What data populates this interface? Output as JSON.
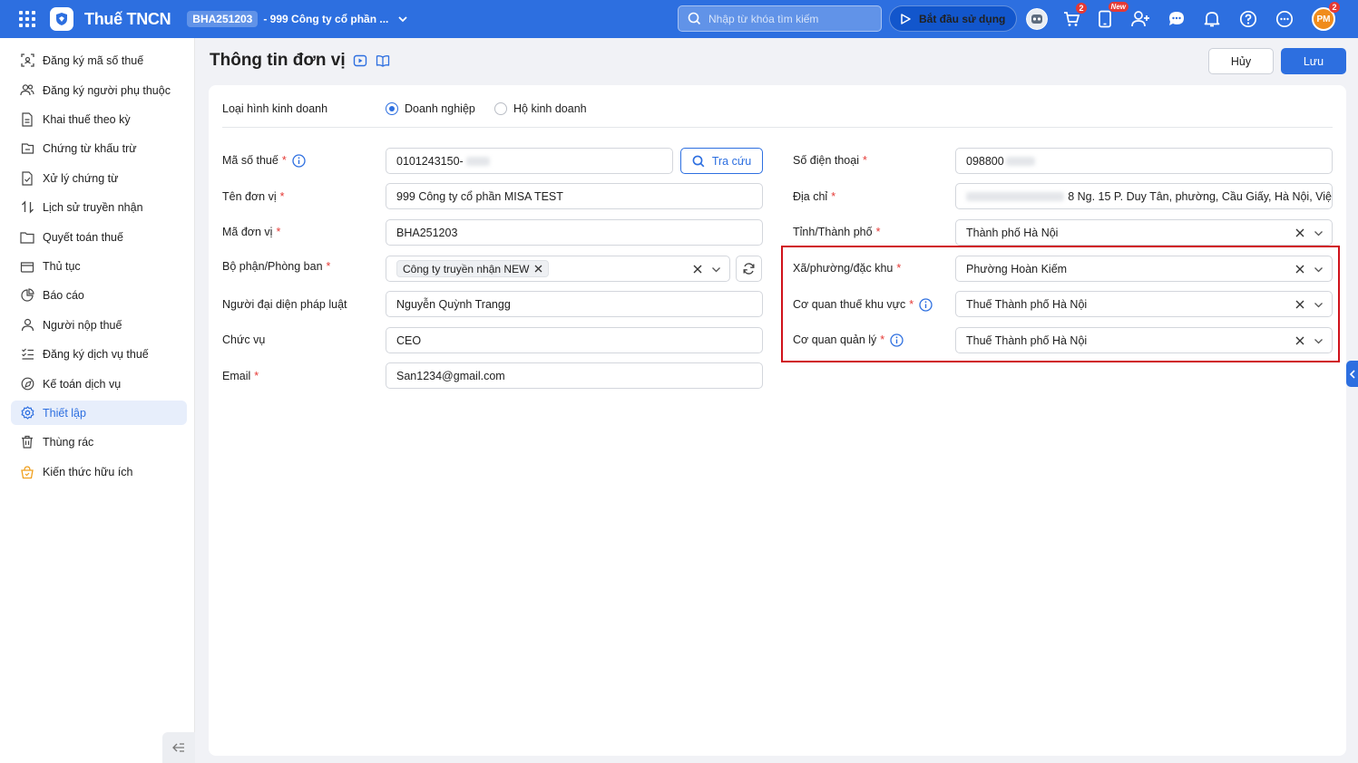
{
  "header": {
    "app_title": "Thuế TNCN",
    "org_code": "BHA251203",
    "org_name": "- 999 Công ty cổ phần ...",
    "search_placeholder": "Nhập từ khóa tìm kiếm",
    "start_label": "Bắt đầu sử dụng",
    "cart_badge": "2",
    "new_badge": "New",
    "avatar_initials": "PM",
    "avatar_badge": "2",
    "brand_color": "#2d6fe0"
  },
  "sidebar": {
    "items": [
      {
        "label": "Đăng ký mã số thuế",
        "icon": "scan-icon"
      },
      {
        "label": "Đăng ký người phụ thuộc",
        "icon": "users-icon"
      },
      {
        "label": "Khai thuế theo kỳ",
        "icon": "document-icon"
      },
      {
        "label": "Chứng từ khấu trừ",
        "icon": "receipt-icon"
      },
      {
        "label": "Xử lý chứng từ",
        "icon": "document-check-icon"
      },
      {
        "label": "Lịch sử truyền nhận",
        "icon": "transfer-icon"
      },
      {
        "label": "Quyết toán thuế",
        "icon": "folder-icon"
      },
      {
        "label": "Thủ tục",
        "icon": "box-icon"
      },
      {
        "label": "Báo cáo",
        "icon": "pie-chart-icon"
      },
      {
        "label": "Người nộp thuế",
        "icon": "user-icon"
      },
      {
        "label": "Đăng ký dịch vụ thuế",
        "icon": "checklist-icon"
      },
      {
        "label": "Kế toán dịch vụ",
        "icon": "compass-icon"
      },
      {
        "label": "Thiết lập",
        "icon": "gear-icon"
      },
      {
        "label": "Thùng rác",
        "icon": "trash-icon"
      },
      {
        "label": "Kiến thức hữu ích",
        "icon": "lightbulb-icon"
      }
    ],
    "active_index": 12
  },
  "page": {
    "title": "Thông tin đơn vị",
    "cancel_label": "Hủy",
    "save_label": "Lưu"
  },
  "form": {
    "business_type": {
      "label": "Loại hình kinh doanh",
      "options": [
        "Doanh nghiệp",
        "Hộ kinh doanh"
      ],
      "selected": "Doanh nghiệp"
    },
    "tax_code": {
      "label": "Mã số thuế",
      "value": "0101243150-",
      "lookup_label": "Tra cứu"
    },
    "unit_name": {
      "label": "Tên đơn vị",
      "value": "999 Công ty cổ phần MISA TEST"
    },
    "unit_code": {
      "label": "Mã đơn vị",
      "value": "BHA251203"
    },
    "department": {
      "label": "Bộ phận/Phòng ban",
      "tag": "Công ty truyền nhận NEW"
    },
    "legal_rep": {
      "label": "Người đại diện pháp luật",
      "value": "Nguyễn Quỳnh Trangg"
    },
    "position": {
      "label": "Chức vụ",
      "value": "CEO"
    },
    "email": {
      "label": "Email",
      "value": "San1234@gmail.com"
    },
    "phone": {
      "label": "Số điện thoại",
      "value": "098800"
    },
    "address": {
      "label": "Địa chỉ",
      "value": "8 Ng. 15 P. Duy Tân, phường, Cầu Giấy, Hà Nội, Việ"
    },
    "province": {
      "label": "Tỉnh/Thành phố",
      "value": "Thành phố Hà Nội"
    },
    "ward": {
      "label": "Xã/phường/đặc khu",
      "value": "Phường Hoàn Kiếm"
    },
    "regional_tax": {
      "label": "Cơ quan thuế khu vực",
      "value": "Thuế Thành phố Hà Nội"
    },
    "managing_tax": {
      "label": "Cơ quan quản lý",
      "value": "Thuế Thành phố Hà Nội"
    },
    "required_mark": "*",
    "highlight_color": "#d0121b"
  }
}
